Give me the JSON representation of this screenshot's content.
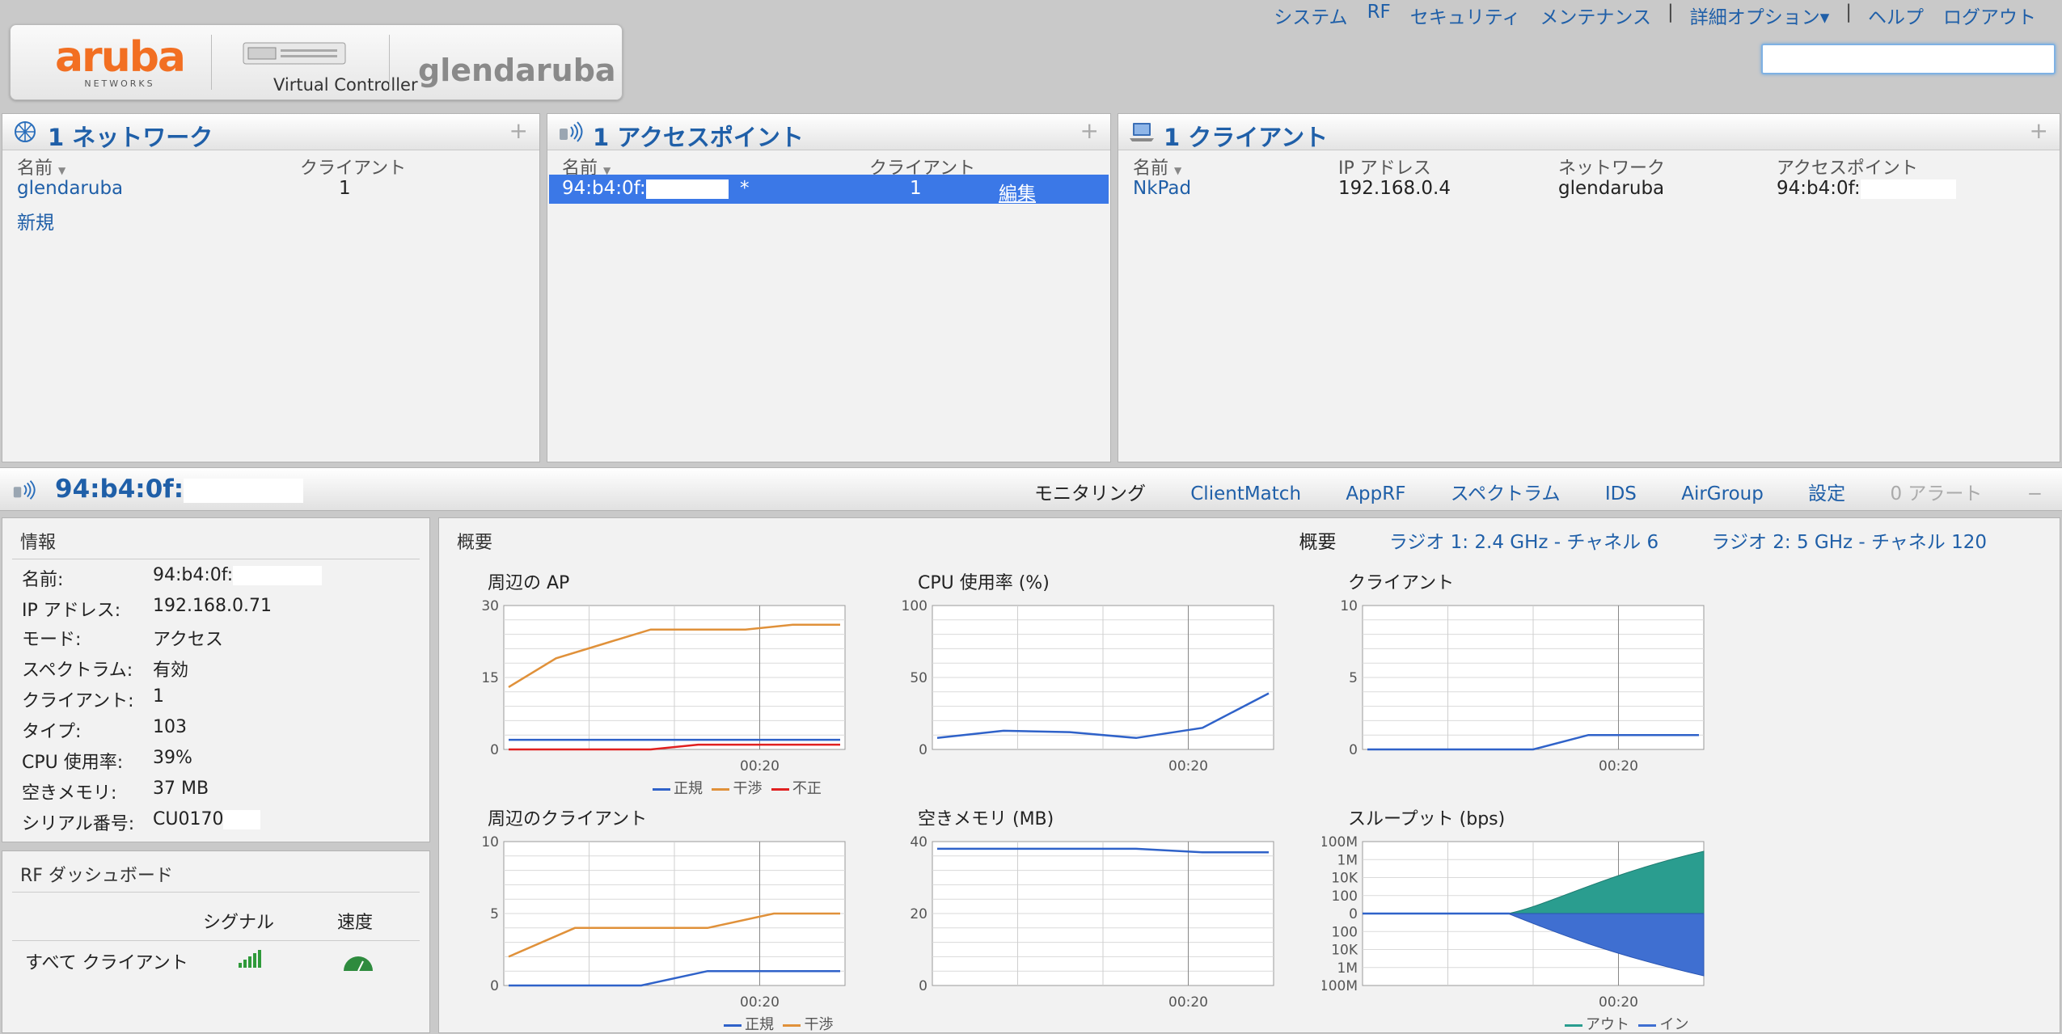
{
  "header": {
    "logo_word": "aruba",
    "logo_sub": "NETWORKS",
    "product": "Virtual Controller",
    "hostname": "glendaruba",
    "nav": [
      "システム",
      "RF",
      "セキュリティ",
      "メンテナンス",
      "詳細オプション▾",
      "ヘルプ",
      "ログアウト"
    ],
    "search_value": ""
  },
  "networks": {
    "title": "1 ネットワーク",
    "col_name": "名前",
    "col_clients": "クライアント",
    "rows": [
      {
        "name": "glendaruba",
        "clients": "1"
      }
    ],
    "new_link": "新規"
  },
  "access_points": {
    "title": "1 アクセスポイント",
    "col_name": "名前",
    "col_clients": "クライアント",
    "rows": [
      {
        "name": "94:b4:0f:",
        "star": "*",
        "clients": "1",
        "action": "編集"
      }
    ]
  },
  "clients": {
    "title": "1 クライアント",
    "col_name": "名前",
    "col_ip": "IP アドレス",
    "col_network": "ネットワーク",
    "col_ap": "アクセスポイント",
    "rows": [
      {
        "name": "NkPad",
        "ip": "192.168.0.4",
        "network": "glendaruba",
        "ap": "94:b4:0f:"
      }
    ]
  },
  "ap_detail": {
    "title": "94:b4:0f:",
    "tabs": [
      "モニタリング",
      "ClientMatch",
      "AppRF",
      "スペクトラム",
      "IDS",
      "AirGroup",
      "設定",
      "0 アラート"
    ],
    "collapse": "−"
  },
  "info": {
    "heading": "情報",
    "items": [
      {
        "k": "名前:",
        "v": "94:b4:0f:"
      },
      {
        "k": "IP アドレス:",
        "v": "192.168.0.71"
      },
      {
        "k": "モード:",
        "v": "アクセス"
      },
      {
        "k": "スペクトラム:",
        "v": "有効"
      },
      {
        "k": "クライアント:",
        "v": "1"
      },
      {
        "k": "タイプ:",
        "v": "103"
      },
      {
        "k": "CPU 使用率:",
        "v": "39%"
      },
      {
        "k": "空きメモリ:",
        "v": "37 MB"
      },
      {
        "k": "シリアル番号:",
        "v": "CU0170"
      }
    ]
  },
  "rf_dashboard": {
    "heading": "RF ダッシュボード",
    "col_signal": "シグナル",
    "col_speed": "速度",
    "row_label": "すべて クライアント"
  },
  "overview": {
    "heading": "概要",
    "tabs": [
      "概要",
      "ラジオ 1: 2.4 GHz - チャネル 6",
      "ラジオ 2: 5 GHz - チャネル 120"
    ]
  },
  "chart_data": [
    {
      "title": "周辺の AP",
      "type": "line",
      "yticks": [
        "30",
        "15",
        "0"
      ],
      "ylim": [
        0,
        30
      ],
      "xtick": "00:20",
      "series": [
        {
          "name": "正規",
          "color": "#2f62c9",
          "values": [
            2,
            2,
            2,
            2,
            2,
            2,
            2,
            2
          ]
        },
        {
          "name": "干渉",
          "color": "#e0913a",
          "values": [
            13,
            19,
            22,
            25,
            25,
            25,
            26,
            26
          ]
        },
        {
          "name": "不正",
          "color": "#e02020",
          "values": [
            0,
            0,
            0,
            0,
            1,
            1,
            1,
            1
          ]
        }
      ]
    },
    {
      "title": "CPU 使用率  (%)",
      "type": "line",
      "yticks": [
        "100",
        "50",
        "0"
      ],
      "ylim": [
        0,
        100
      ],
      "xtick": "00:20",
      "series": [
        {
          "name": "",
          "color": "#2f62c9",
          "values": [
            8,
            13,
            12,
            8,
            15,
            39
          ]
        }
      ]
    },
    {
      "title": "クライアント",
      "type": "line",
      "yticks": [
        "10",
        "5",
        "0"
      ],
      "ylim": [
        0,
        10
      ],
      "xtick": "00:20",
      "series": [
        {
          "name": "",
          "color": "#2f62c9",
          "values": [
            0,
            0,
            0,
            0,
            1,
            1,
            1
          ]
        }
      ]
    },
    {
      "title": "周辺のクライアント",
      "type": "line",
      "yticks": [
        "10",
        "5",
        "0"
      ],
      "ylim": [
        0,
        10
      ],
      "xtick": "00:20",
      "series": [
        {
          "name": "正規",
          "color": "#2f62c9",
          "values": [
            0,
            0,
            0,
            1,
            1,
            1
          ]
        },
        {
          "name": "干渉",
          "color": "#e0913a",
          "values": [
            2,
            4,
            4,
            4,
            5,
            5
          ]
        }
      ]
    },
    {
      "title": "空きメモリ  (MB)",
      "type": "line",
      "yticks": [
        "40",
        "20",
        "0"
      ],
      "ylim": [
        0,
        40
      ],
      "xtick": "00:20",
      "series": [
        {
          "name": "",
          "color": "#2f62c9",
          "values": [
            38,
            38,
            38,
            38,
            37,
            37
          ]
        }
      ]
    },
    {
      "title": "スループット  (bps)",
      "type": "area",
      "yticks": [
        "100M",
        "1M",
        "10K",
        "100",
        "0",
        "100",
        "10K",
        "1M",
        "100M"
      ],
      "xtick": "00:20",
      "series": [
        {
          "name": "アウト",
          "color": "#2a9d8f"
        },
        {
          "name": "イン",
          "color": "#3f6fd1"
        }
      ]
    }
  ]
}
